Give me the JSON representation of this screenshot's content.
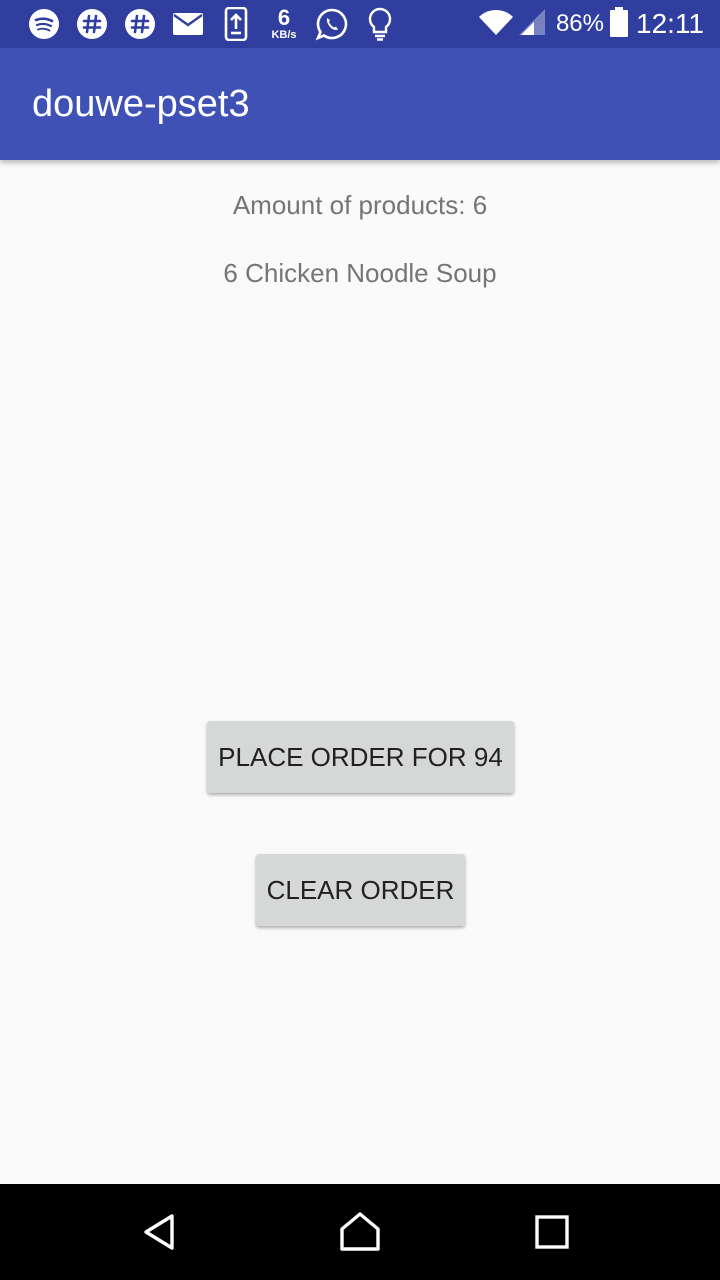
{
  "status_bar": {
    "notification_icons": [
      "spotify-icon",
      "slack-icon",
      "slack-icon",
      "mail-icon",
      "upload-icon",
      "network-speed",
      "whatsapp-icon",
      "lightbulb-icon"
    ],
    "network_speed_value": "6",
    "network_speed_unit": "KB/s",
    "battery_percent": "86%",
    "time": "12:11"
  },
  "app_bar": {
    "title": "douwe-pset3",
    "color": "#3f51b5"
  },
  "content": {
    "amount_text": "Amount of products: 6",
    "order_items": [
      "6 Chicken Noodle Soup"
    ]
  },
  "buttons": {
    "place_order": "PLACE ORDER FOR 94",
    "clear_order": "CLEAR ORDER"
  },
  "nav_bar": {
    "icons": [
      "back-icon",
      "home-icon",
      "recents-icon"
    ]
  },
  "colors": {
    "status_bar": "#303f9f",
    "app_bar": "#3f51b5",
    "background": "#fafafa",
    "text_secondary": "#757575",
    "button_bg": "#d6d7d7"
  }
}
